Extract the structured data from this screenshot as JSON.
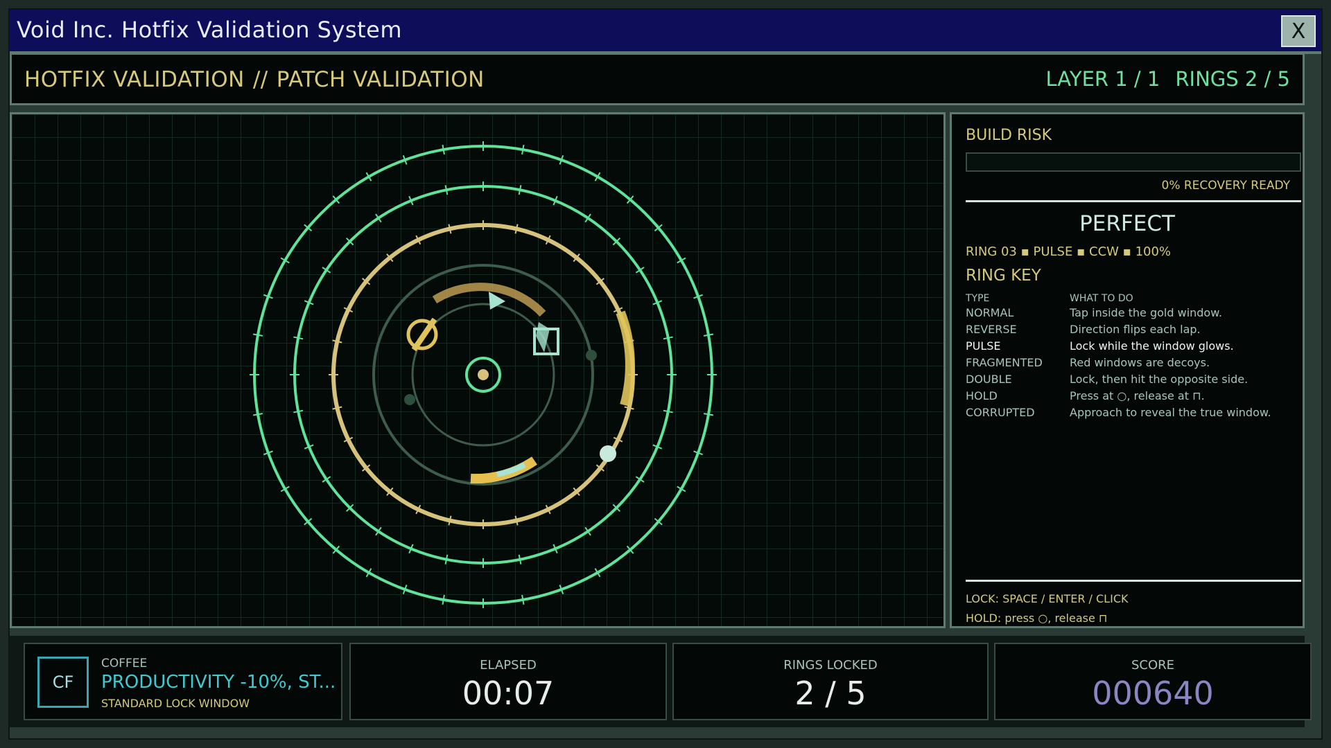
{
  "window": {
    "title": "Void Inc. Hotfix Validation System",
    "close_label": "X"
  },
  "header": {
    "section": "HOTFIX VALIDATION",
    "separator": "//",
    "subsection": "PATCH VALIDATION",
    "layer": "LAYER 1 / 1",
    "rings": "RINGS 2 / 5"
  },
  "sidebar": {
    "build_risk_label": "BUILD RISK",
    "build_risk_fraction": 0,
    "build_risk_text": "0%  RECOVERY READY",
    "verdict": "PERFECT",
    "ring_info": "RING 03  ▪  PULSE  ▪  CCW  ▪  100%",
    "ring_key_label": "RING KEY",
    "ring_key_headers": [
      "TYPE",
      "WHAT TO DO"
    ],
    "ring_key_rows": [
      {
        "type": "NORMAL",
        "desc": "Tap inside the gold window."
      },
      {
        "type": "REVERSE",
        "desc": "Direction flips each lap."
      },
      {
        "type": "PULSE",
        "desc": "Lock while the window glows."
      },
      {
        "type": "FRAGMENTED",
        "desc": "Red windows are decoys."
      },
      {
        "type": "DOUBLE",
        "desc": "Lock, then hit the opposite side."
      },
      {
        "type": "HOLD",
        "desc": "Press at ○, release at ⊓."
      },
      {
        "type": "CORRUPTED",
        "desc": "Approach to reveal the true window."
      }
    ],
    "lock_hint": "LOCK: SPACE / ENTER / CLICK",
    "hold_hint": "HOLD: press ○, release ⊓"
  },
  "footer": {
    "powerup": {
      "badge": "CF",
      "caption": "COFFEE",
      "effect": "PRODUCTIVITY -10%, ST...",
      "sub": "STANDARD LOCK WINDOW"
    },
    "elapsed": {
      "label": "ELAPSED",
      "value": "00:07"
    },
    "rings_locked": {
      "label": "RINGS LOCKED",
      "value": "2 / 5"
    },
    "score": {
      "label": "SCORE",
      "value": "000640"
    }
  },
  "colors": {
    "ring_locked": "#5fe39a",
    "ring_active": "#d6c27a",
    "ring_idle": "#3c5c4c",
    "accent_gold": "#d6c97b",
    "score": "#8a86c4"
  }
}
